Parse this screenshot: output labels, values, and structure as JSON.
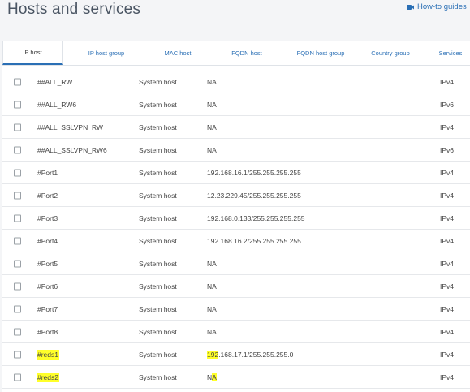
{
  "header": {
    "title": "Hosts and services",
    "guides_label": "How-to guides",
    "guides_icon": "video-camera-icon"
  },
  "tabs": [
    {
      "label": "IP host",
      "active": true
    },
    {
      "label": "IP host group",
      "active": false
    },
    {
      "label": "MAC host",
      "active": false
    },
    {
      "label": "FQDN host",
      "active": false
    },
    {
      "label": "FQDN host group",
      "active": false
    },
    {
      "label": "Country group",
      "active": false
    },
    {
      "label": "Services",
      "active": false
    }
  ],
  "rows": [
    {
      "name": "##ALL_RW",
      "type": "System host",
      "ip": "NA",
      "version": "IPv4"
    },
    {
      "name": "##ALL_RW6",
      "type": "System host",
      "ip": "NA",
      "version": "IPv6"
    },
    {
      "name": "##ALL_SSLVPN_RW",
      "type": "System host",
      "ip": "NA",
      "version": "IPv4"
    },
    {
      "name": "##ALL_SSLVPN_RW6",
      "type": "System host",
      "ip": "NA",
      "version": "IPv6"
    },
    {
      "name": "#Port1",
      "type": "System host",
      "ip": "192.168.16.1/255.255.255.255",
      "version": "IPv4"
    },
    {
      "name": "#Port2",
      "type": "System host",
      "ip": "12.23.229.45/255.255.255.255",
      "version": "IPv4"
    },
    {
      "name": "#Port3",
      "type": "System host",
      "ip": "192.168.0.133/255.255.255.255",
      "version": "IPv4"
    },
    {
      "name": "#Port4",
      "type": "System host",
      "ip": "192.168.16.2/255.255.255.255",
      "version": "IPv4"
    },
    {
      "name": "#Port5",
      "type": "System host",
      "ip": "NA",
      "version": "IPv4"
    },
    {
      "name": "#Port6",
      "type": "System host",
      "ip": "NA",
      "version": "IPv4"
    },
    {
      "name": "#Port7",
      "type": "System host",
      "ip": "NA",
      "version": "IPv4"
    },
    {
      "name": "#Port8",
      "type": "System host",
      "ip": "NA",
      "version": "IPv4"
    },
    {
      "name": "#reds1",
      "type": "System host",
      "ip": "192.168.17.1/255.255.255.0",
      "version": "IPv4"
    },
    {
      "name": "#reds2",
      "type": "System host",
      "ip": "NA",
      "version": "IPv4"
    }
  ],
  "highlight_color": "#ffff2a",
  "link_color": "#2a6fb5"
}
